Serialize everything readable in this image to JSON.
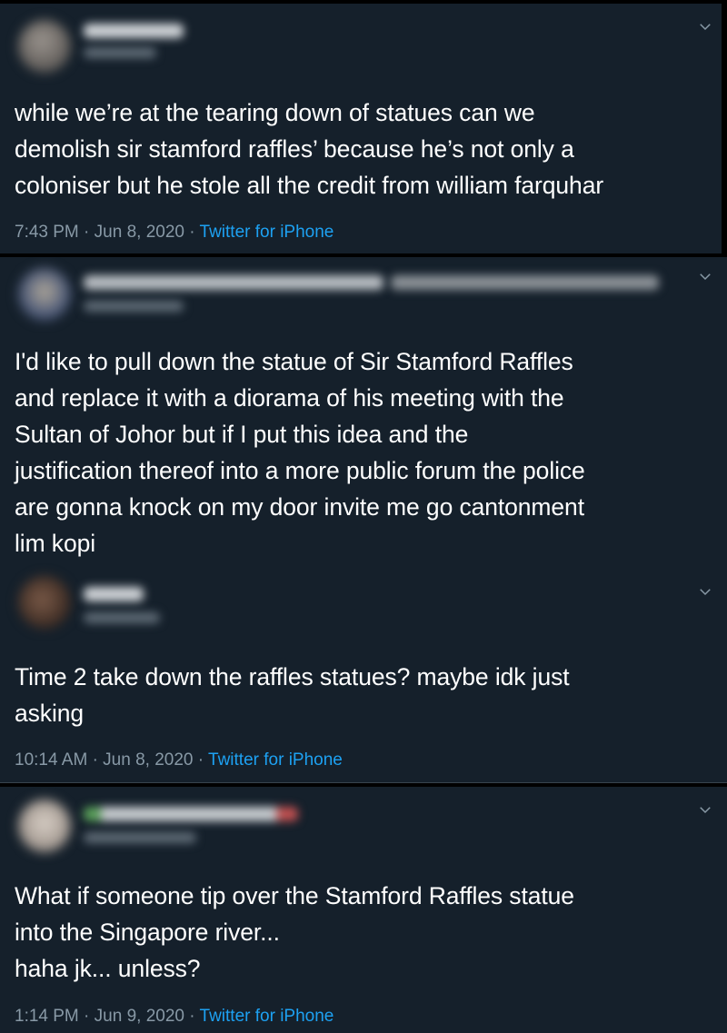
{
  "tweets": [
    {
      "text_lines": [
        "while we’re at the tearing down of statues can we",
        "demolish sir stamford raffles’ because he’s not only a",
        "coloniser but he stole all the credit from william farquhar"
      ],
      "time": "7:43 PM",
      "date": "Jun 8, 2020",
      "source": "Twitter for iPhone",
      "separator": "·"
    },
    {
      "text_lines": [
        "I'd like to pull down the statue of Sir Stamford Raffles",
        "and replace it with a diorama of his meeting with the",
        "Sultan of Johor but if I put this idea and the",
        "justification thereof into a more public forum the police",
        "are gonna knock on my door invite me go cantonment",
        "lim kopi"
      ]
    },
    {
      "text_lines": [
        "Time 2 take down the raffles statues? maybe idk just",
        "asking"
      ],
      "time": "10:14 AM",
      "date": "Jun 8, 2020",
      "source": "Twitter for iPhone",
      "separator": "·"
    },
    {
      "text_lines": [
        "What if someone tip over the Stamford Raffles statue",
        "into the Singapore river...",
        "haha jk... unless?"
      ],
      "time": "1:14 PM",
      "date": "Jun 9, 2020",
      "source": "Twitter for iPhone",
      "separator": "·"
    }
  ],
  "icons": {
    "chevron": "chevron-down-icon"
  },
  "colors": {
    "background": "#15202b",
    "text": "#ffffff",
    "muted": "#8899a6",
    "link": "#1da1f2",
    "border": "#38444d"
  }
}
